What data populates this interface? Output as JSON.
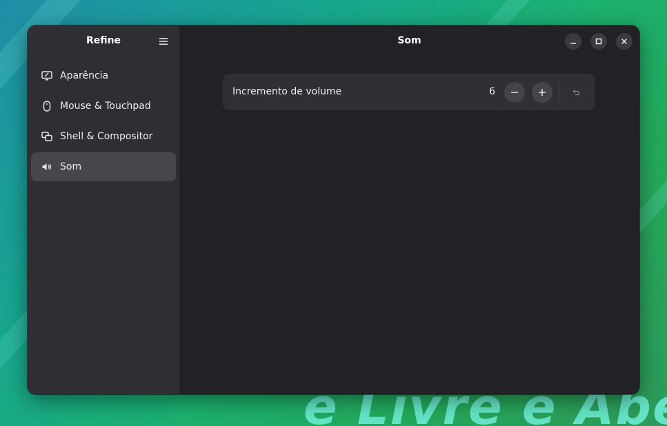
{
  "app": {
    "sidebar_title": "Refine",
    "content_title": "Som"
  },
  "sidebar": {
    "items": [
      {
        "label": "Aparência",
        "icon": "display-icon",
        "active": false
      },
      {
        "label": "Mouse & Touchpad",
        "icon": "mouse-icon",
        "active": false
      },
      {
        "label": "Shell & Compositor",
        "icon": "windows-icon",
        "active": false
      },
      {
        "label": "Som",
        "icon": "speaker-icon",
        "active": true
      }
    ]
  },
  "setting": {
    "label": "Incremento de volume",
    "value": "6"
  },
  "wallpaper": {
    "text": "e Livre e Abe"
  },
  "colors": {
    "sidebar_bg": "#2e2e33",
    "content_bg": "#222226",
    "active_item": "#46464d",
    "row_bg": "#2f2f35"
  }
}
